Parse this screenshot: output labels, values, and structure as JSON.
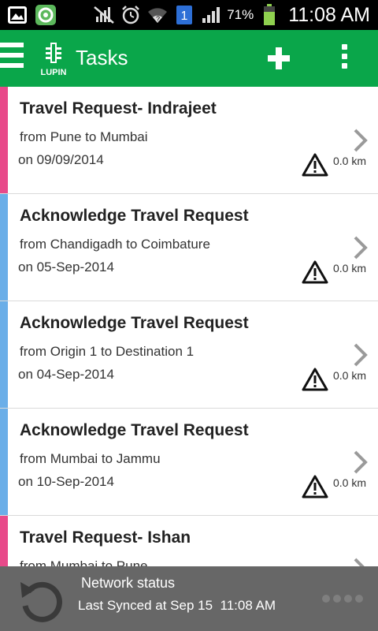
{
  "status_bar": {
    "battery_percent": "71%",
    "time": "11:08 AM",
    "sim_badge": "1",
    "icons": [
      "gallery-icon",
      "app-circle-icon",
      "mute-icon",
      "alarm-icon",
      "wifi-icon",
      "sim-icon",
      "signal-icon",
      "battery-icon"
    ]
  },
  "appbar": {
    "title": "Tasks",
    "logo_text": "LUPIN",
    "brand_color": "#0aa64a"
  },
  "tasks": [
    {
      "title": "Travel Request- Indrajeet",
      "route": "from Pune to Mumbai",
      "date": "on 09/09/2014",
      "distance": "0.0 km",
      "stripe_color": "#e84a8a"
    },
    {
      "title": "Acknowledge Travel Request",
      "route": "from Chandigadh to Coimbature",
      "date": "on 05-Sep-2014",
      "distance": "0.0 km",
      "stripe_color": "#6aaee8"
    },
    {
      "title": "Acknowledge Travel Request",
      "route": "from Origin 1 to Destination 1",
      "date": "on 04-Sep-2014",
      "distance": "0.0 km",
      "stripe_color": "#6aaee8"
    },
    {
      "title": "Acknowledge Travel Request",
      "route": "from Mumbai to Jammu",
      "date": "on 10-Sep-2014",
      "distance": "0.0 km",
      "stripe_color": "#6aaee8"
    },
    {
      "title": "Travel Request- Ishan",
      "route": "from Mumbai to Pune",
      "date": "",
      "distance": "",
      "stripe_color": "#e84a8a"
    }
  ],
  "network": {
    "title": "Network status",
    "last_synced": "Last Synced at Sep 15  11:08 AM"
  }
}
